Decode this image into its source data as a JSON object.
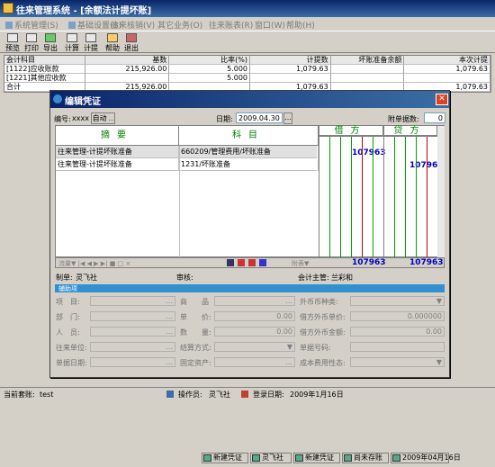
{
  "app": {
    "title": "往来管理系统 - [余额法计提坏账]"
  },
  "menu": [
    "系统管理(S)",
    "基础设置(B)",
    "往来核销(V)",
    "其它业务(O)",
    "往来账表(R)",
    "窗口(W)",
    "帮助(H)"
  ],
  "toolbar": [
    "预览",
    "打印",
    "导出",
    "计算",
    "计提",
    "帮助",
    "退出"
  ],
  "summary": {
    "headers": [
      "会计科目",
      "基数",
      "比率(%)",
      "计提数",
      "坏账准备余额",
      "本次计提"
    ],
    "rows": [
      [
        "[1122]应收账款",
        "215,926.00",
        "5.000",
        "1,079.63",
        "",
        "1,079.63"
      ],
      [
        "[1221]其他应收款",
        "",
        "5.000",
        "",
        "",
        ""
      ],
      [
        "合计",
        "215,926.00",
        "",
        "1,079.63",
        "",
        "1,079.63"
      ]
    ]
  },
  "dialog": {
    "title": "编辑凭证",
    "voucher_no_label": "编号:",
    "voucher_no": "xxxx",
    "auto_label": "自动",
    "date_label": "日期:",
    "date": "2009.04.30",
    "attach_label": "附单据数:",
    "attach_count": "0",
    "col_summary": "摘要",
    "col_account": "科目",
    "col_debit": "借方",
    "col_credit": "贷方",
    "entries": [
      {
        "summary": "往来管理-计提坏账准备",
        "account": "660209/管理费用/坏账准备",
        "debit": "107963",
        "credit": ""
      },
      {
        "summary": "往来管理-计提坏账准备",
        "account": "1231/坏账准备",
        "debit": "",
        "credit": "107963"
      }
    ],
    "footer_nav": "流量▼ |◀ ◀ ▶ ▶| ■ □ ×",
    "footer_right": "附表▼",
    "total_debit": "107963",
    "total_credit": "107963",
    "maker_label": "制单:",
    "maker": "灵飞社",
    "audit_label": "审核:",
    "supervisor_label": "会计主管:",
    "supervisor": "兰彩和",
    "aux_band": "辅助项",
    "fields_left": [
      "项　目:",
      "部　门:",
      "人　员:",
      "往来单位:",
      "单据日期:"
    ],
    "fields_mid": [
      "商　　品",
      "单　　价:",
      "数　　量:",
      "结算方式:",
      "固定资产:"
    ],
    "fields_right": [
      "外币币种类:",
      "借方外币单价:",
      "借方外币金额:",
      "单据号码:",
      "成本费用性态:"
    ],
    "field_values": {
      "price": "0.00",
      "qty": "0.00",
      "rate": "0.000000",
      "amount": "0.00"
    },
    "bottom_buttons": [
      "新建凭证",
      "灵飞社",
      "新建凭证",
      "尚未存账",
      "2009年04月16日"
    ]
  },
  "status": {
    "account_set_label": "当前套账:",
    "account_set": "test",
    "operator_label": "操作员:",
    "operator": "灵飞社",
    "login_label": "登录日期:",
    "login_date": "2009年1月16日"
  }
}
